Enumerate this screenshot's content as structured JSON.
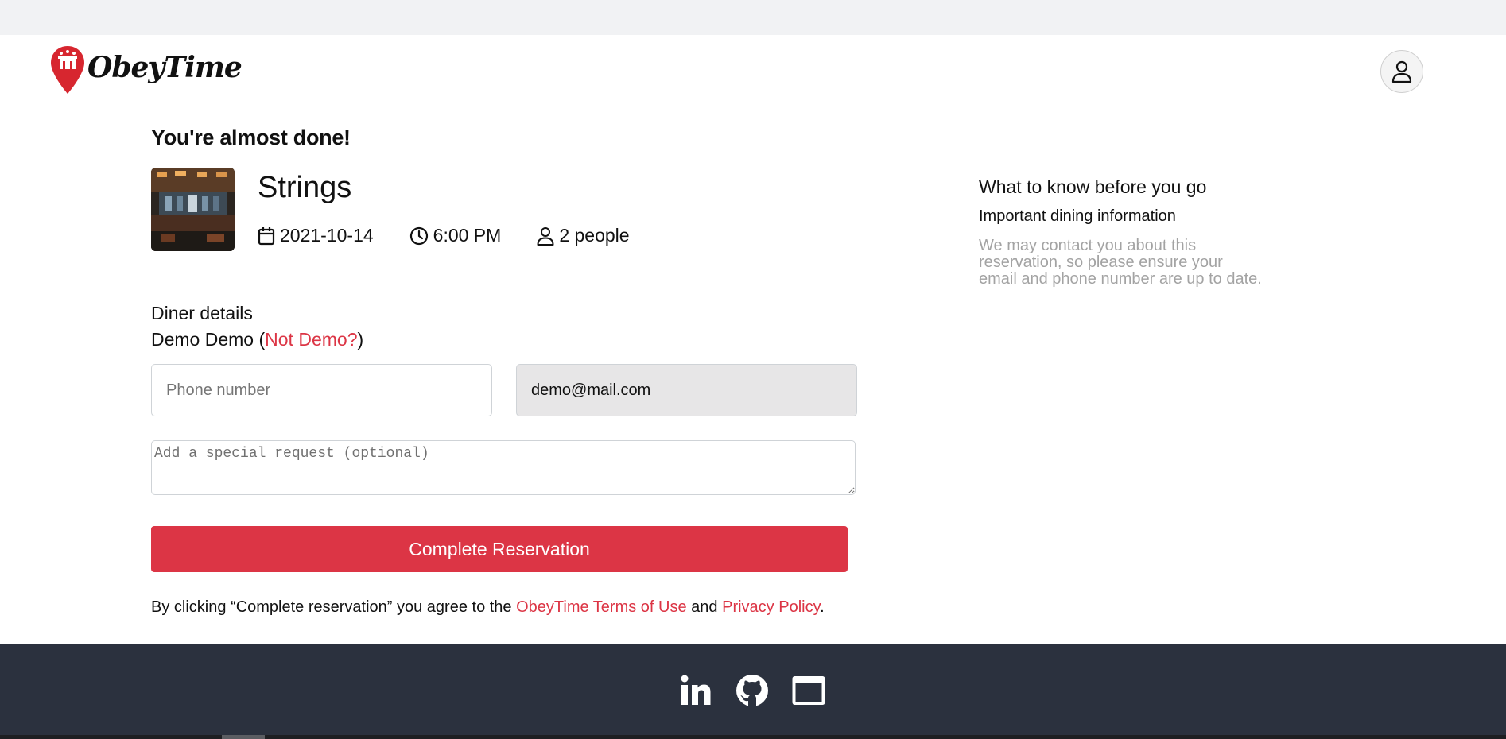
{
  "header": {
    "brand": "ObeyTime"
  },
  "page": {
    "heading": "You're almost done!"
  },
  "restaurant": {
    "name": "Strings",
    "date": "2021-10-14",
    "time": "6:00 PM",
    "party": "2 people"
  },
  "diner": {
    "heading": "Diner details",
    "name_prefix": "Demo Demo (",
    "not_link": "Not Demo?",
    "name_suffix": ")"
  },
  "form": {
    "phone_placeholder": "Phone number",
    "phone_value": "",
    "email_value": "demo@mail.com",
    "request_placeholder": "Add a special request (optional)",
    "submit_label": "Complete Reservation"
  },
  "terms": {
    "prefix": "By clicking “Complete reservation” you agree to the ",
    "terms_link": "ObeyTime Terms of Use",
    "middle": " and ",
    "privacy_link": "Privacy Policy",
    "suffix": "."
  },
  "sidebar": {
    "heading": "What to know before you go",
    "subheading": "Important dining information",
    "body": "We may contact you about this reservation, so please ensure your email and phone number are up to date."
  },
  "footer": {
    "icons": [
      "linkedin-icon",
      "github-icon",
      "browser-window-icon"
    ]
  },
  "colors": {
    "accent": "#dc3545",
    "footer_bg": "#2b313e",
    "muted_text": "#a3a3a3"
  }
}
